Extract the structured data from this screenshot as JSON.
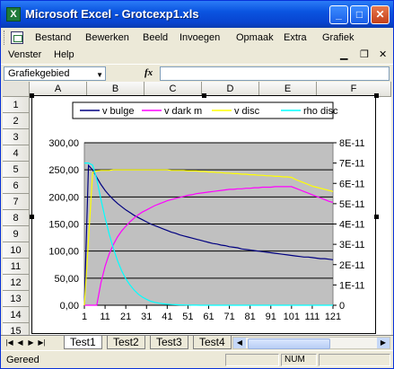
{
  "window": {
    "title": "Microsoft Excel - Grotcexp1.xls",
    "app_icon": "X"
  },
  "menu": {
    "items": [
      "Bestand",
      "Bewerken",
      "Beeld",
      "Invoegen",
      "Opmaak",
      "Extra",
      "Grafiek"
    ],
    "items2": [
      "Venster",
      "Help"
    ]
  },
  "formula_bar": {
    "name_box": "Grafiekgebied",
    "fx": "fx",
    "value": ""
  },
  "columns": [
    "A",
    "B",
    "C",
    "D",
    "E",
    "F"
  ],
  "rows": [
    "1",
    "2",
    "3",
    "4",
    "5",
    "6",
    "7",
    "8",
    "9",
    "10",
    "11",
    "12",
    "13",
    "14",
    "15"
  ],
  "sheets": [
    "Test1",
    "Test2",
    "Test3",
    "Test4"
  ],
  "active_sheet": "Test1",
  "status": {
    "text": "Gereed",
    "mode": "NUM"
  },
  "chart_data": {
    "type": "line",
    "x": [
      1,
      3,
      5,
      7,
      9,
      11,
      13,
      15,
      17,
      19,
      21,
      23,
      25,
      27,
      29,
      31,
      33,
      35,
      37,
      39,
      41,
      43,
      45,
      47,
      49,
      51,
      53,
      55,
      57,
      59,
      61,
      63,
      65,
      67,
      69,
      71,
      73,
      75,
      77,
      79,
      81,
      83,
      85,
      87,
      89,
      91,
      93,
      95,
      97,
      99,
      101,
      103,
      105,
      107,
      109,
      111,
      113,
      115,
      117,
      119,
      121
    ],
    "xticks": [
      "1",
      "11",
      "21",
      "31",
      "41",
      "51",
      "61",
      "71",
      "81",
      "91",
      "101",
      "111",
      "121"
    ],
    "y_left": {
      "ticks": [
        "0,00",
        "50,00",
        "100,00",
        "150,00",
        "200,00",
        "250,00",
        "300,00"
      ],
      "min": 0,
      "max": 300
    },
    "y_right": {
      "ticks": [
        "0",
        "1E-11",
        "2E-11",
        "3E-11",
        "4E-11",
        "5E-11",
        "6E-11",
        "7E-11",
        "8E-11"
      ],
      "min": 0,
      "max": 8e-11
    },
    "legend": [
      "v bulge",
      "v dark m",
      "v disc",
      "rho disc"
    ],
    "colors": {
      "v bulge": "#000080",
      "v dark m": "#ff00ff",
      "v disc": "#ffff00",
      "rho disc": "#00ffff"
    },
    "series": [
      {
        "name": "v bulge",
        "axis": "left",
        "values": [
          0,
          258,
          250,
          236,
          223,
          212,
          203,
          195,
          188,
          182,
          176,
          171,
          166,
          162,
          158,
          154,
          150,
          147,
          144,
          141,
          138,
          135,
          133,
          130,
          128,
          126,
          124,
          122,
          120,
          118,
          116,
          114,
          113,
          111,
          110,
          108,
          107,
          106,
          104,
          103,
          102,
          101,
          100,
          99,
          98,
          97,
          96,
          95,
          94,
          93,
          92,
          91,
          90,
          89,
          89,
          88,
          87,
          86,
          86,
          85,
          84
        ]
      },
      {
        "name": "v dark m",
        "axis": "left",
        "values": [
          0,
          0,
          0,
          0,
          42,
          72,
          95,
          112,
          126,
          137,
          146,
          154,
          161,
          167,
          172,
          176,
          180,
          184,
          187,
          190,
          193,
          195,
          197,
          199,
          201,
          203,
          204,
          206,
          207,
          208,
          209,
          210,
          211,
          212,
          213,
          214,
          214,
          215,
          215,
          216,
          216,
          217,
          217,
          218,
          218,
          218,
          219,
          219,
          219,
          219,
          219,
          216,
          213,
          210,
          207,
          204,
          201,
          198,
          195,
          192,
          190
        ]
      },
      {
        "name": "v disc",
        "axis": "left",
        "values": [
          0,
          120,
          245,
          248,
          249,
          249,
          249,
          250,
          250,
          250,
          250,
          250,
          250,
          250,
          250,
          250,
          250,
          250,
          250,
          250,
          250,
          249,
          249,
          249,
          249,
          248,
          248,
          248,
          247,
          247,
          246,
          246,
          245,
          245,
          244,
          244,
          243,
          243,
          242,
          242,
          241,
          241,
          240,
          240,
          239,
          239,
          238,
          238,
          237,
          237,
          236,
          232,
          229,
          226,
          223,
          220,
          218,
          216,
          214,
          212,
          210
        ]
      },
      {
        "name": "rho disc",
        "axis": "right",
        "values": [
          7e-11,
          7e-11,
          6.9e-11,
          6.2e-11,
          5.2e-11,
          4.3e-11,
          3.5e-11,
          2.8e-11,
          2.2e-11,
          1.7e-11,
          1.3e-11,
          1e-11,
          7.5e-12,
          5.5e-12,
          4e-12,
          2.9e-12,
          2e-12,
          1.4e-12,
          1e-12,
          7e-13,
          5e-13,
          3.5e-13,
          2.5e-13,
          1.7e-13,
          1.2e-13,
          8e-14,
          5e-14,
          3e-14,
          2e-14,
          1e-14,
          0,
          0,
          0,
          0,
          0,
          0,
          0,
          0,
          0,
          0,
          0,
          0,
          0,
          0,
          0,
          0,
          0,
          0,
          0,
          0,
          0,
          0,
          0,
          0,
          0,
          0,
          0,
          0,
          0,
          0,
          0
        ]
      }
    ]
  }
}
